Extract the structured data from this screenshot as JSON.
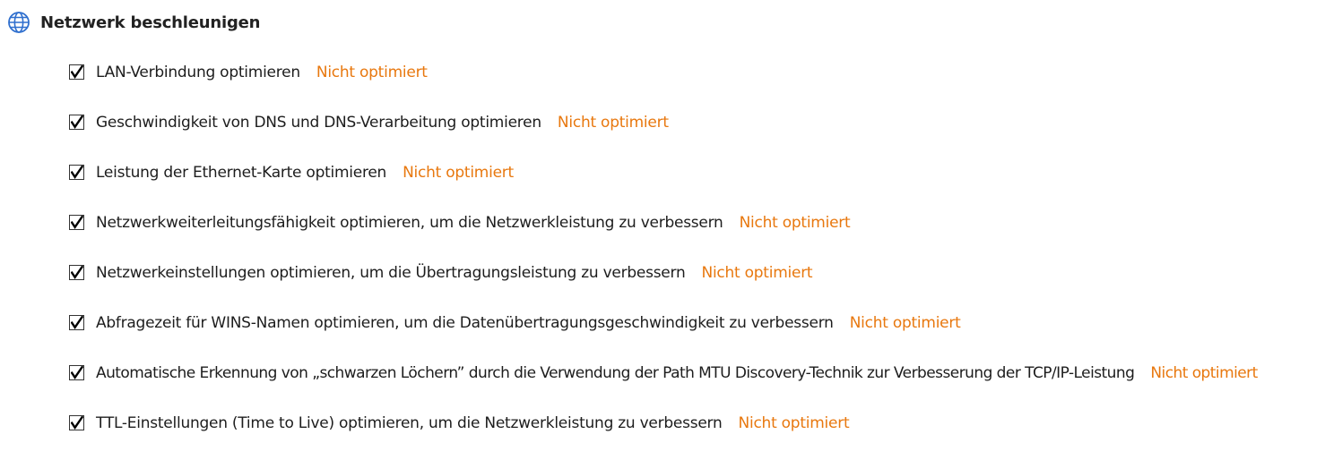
{
  "section": {
    "title": "Netzwerk beschleunigen",
    "icon": "globe-icon",
    "icon_color": "#2f6fce"
  },
  "status_color": "#e8780f",
  "items": [
    {
      "label": "LAN-Verbindung optimieren",
      "status": "Nicht optimiert",
      "checked": true
    },
    {
      "label": "Geschwindigkeit von DNS und DNS-Verarbeitung optimieren",
      "status": "Nicht optimiert",
      "checked": true
    },
    {
      "label": "Leistung der Ethernet-Karte optimieren",
      "status": "Nicht optimiert",
      "checked": true
    },
    {
      "label": "Netzwerkweiterleitungsfähigkeit optimieren, um die Netzwerkleistung zu verbessern",
      "status": "Nicht optimiert",
      "checked": true
    },
    {
      "label": "Netzwerkeinstellungen optimieren, um die Übertragungsleistung zu verbessern",
      "status": "Nicht optimiert",
      "checked": true
    },
    {
      "label": "Abfragezeit für WINS-Namen optimieren, um die Datenübertragungsgeschwindigkeit zu verbessern",
      "status": "Nicht optimiert",
      "checked": true
    },
    {
      "label": "Automatische Erkennung von „schwarzen Löchern” durch die Verwendung der Path MTU Discovery-Technik zur Verbesserung der TCP/IP-Leistung",
      "status": "Nicht optimiert",
      "checked": true
    },
    {
      "label": "TTL-Einstellungen (Time to Live) optimieren, um die Netzwerkleistung zu verbessern",
      "status": "Nicht optimiert",
      "checked": true
    }
  ]
}
